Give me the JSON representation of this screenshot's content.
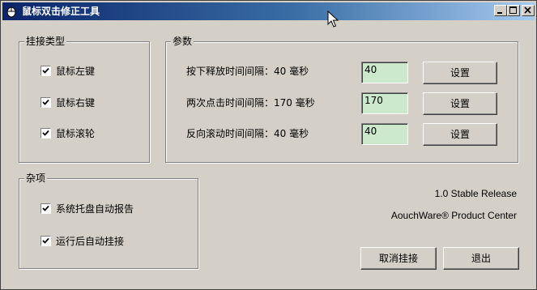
{
  "window": {
    "title": "鼠标双击修正工具",
    "minimize_icon": "minimize-icon",
    "maximize_icon": "maximize-icon",
    "close_icon": "close-icon"
  },
  "hook_type": {
    "label": "挂接类型",
    "items": [
      {
        "label": "鼠标左键",
        "checked": true
      },
      {
        "label": "鼠标右键",
        "checked": true
      },
      {
        "label": "鼠标滚轮",
        "checked": true
      }
    ]
  },
  "params": {
    "label": "参数",
    "rows": [
      {
        "label": "按下释放时间间隔：40 毫秒",
        "value": "40",
        "button": "设置"
      },
      {
        "label": "两次点击时间间隔：170 毫秒",
        "value": "170",
        "button": "设置"
      },
      {
        "label": "反向滚动时间间隔：40 毫秒",
        "value": "40",
        "button": "设置"
      }
    ]
  },
  "misc": {
    "label": "杂项",
    "items": [
      {
        "label": "系统托盘自动报告",
        "checked": true
      },
      {
        "label": "运行后自动挂接",
        "checked": true
      }
    ]
  },
  "info": {
    "version": "1.0 Stable Release",
    "product": "AouchWare® Product Center"
  },
  "footer": {
    "unhook_label": "取消挂接",
    "exit_label": "退出"
  },
  "colors": {
    "titlebar_start": "#0a246a",
    "titlebar_end": "#a6caf0",
    "input_bg": "#cde9cd",
    "face": "#d4d0c8"
  }
}
